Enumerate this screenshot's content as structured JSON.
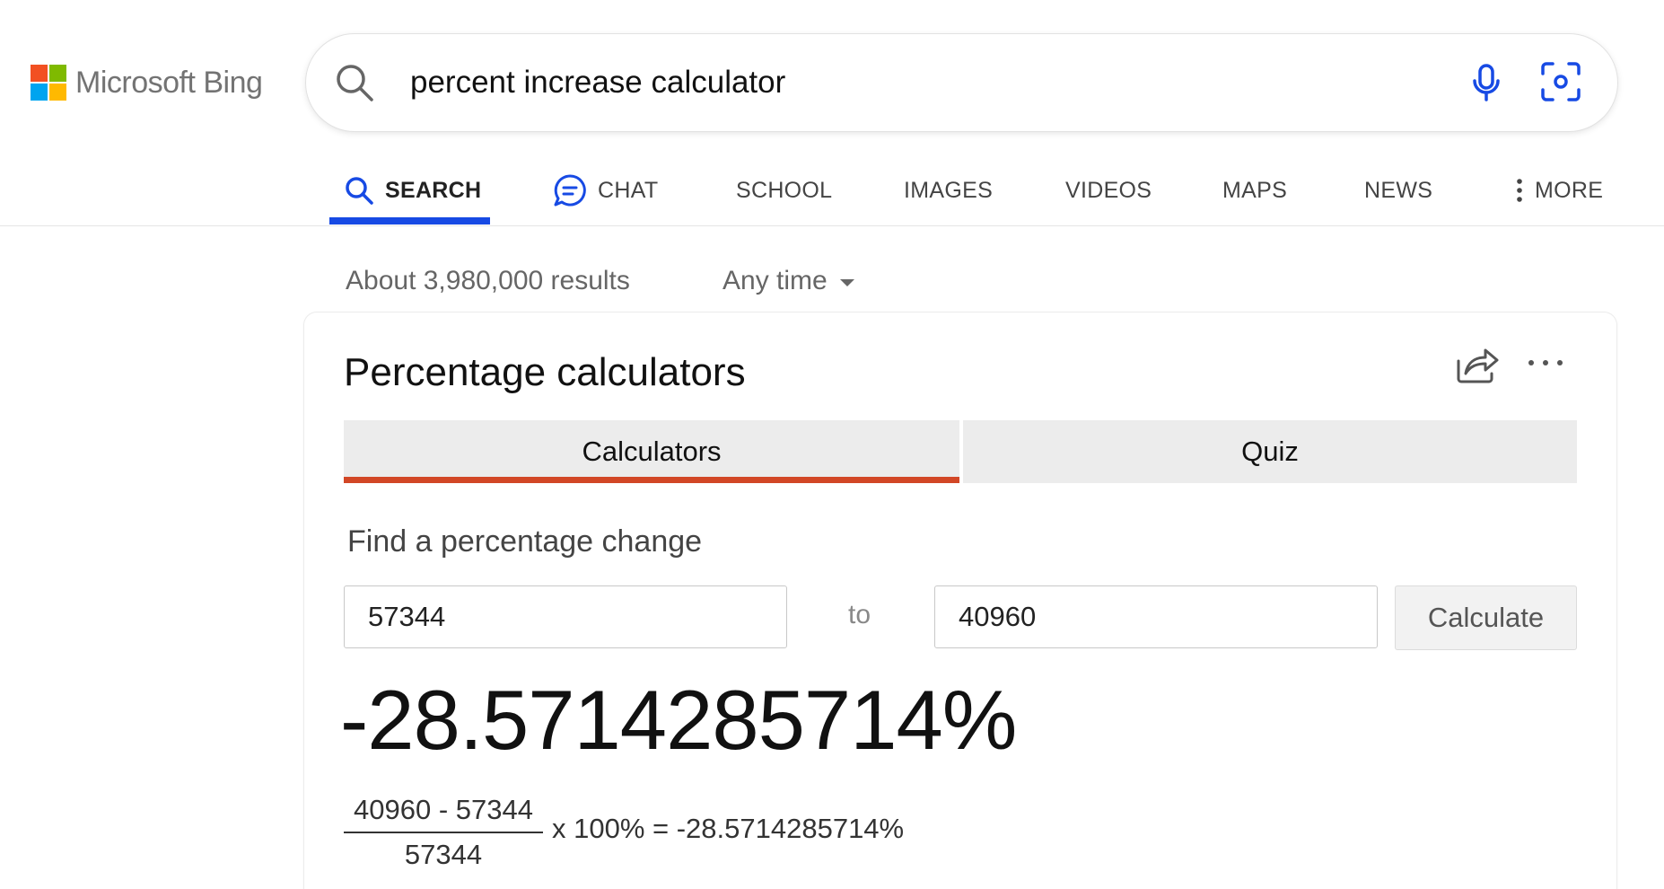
{
  "header": {
    "logo_text": "Microsoft Bing",
    "logo_colors": [
      "#f25022",
      "#7fba00",
      "#00a4ef",
      "#ffb900"
    ],
    "search_query": "percent increase calculator"
  },
  "nav": {
    "accent_color": "#174ae4",
    "items": [
      {
        "label": "SEARCH",
        "icon": "search-icon",
        "active": true
      },
      {
        "label": "CHAT",
        "icon": "chat-icon"
      },
      {
        "label": "SCHOOL"
      },
      {
        "label": "IMAGES"
      },
      {
        "label": "VIDEOS"
      },
      {
        "label": "MAPS"
      },
      {
        "label": "NEWS"
      },
      {
        "label": "MORE",
        "icon": "kebab-icon"
      }
    ]
  },
  "results": {
    "count_text": "About 3,980,000 results",
    "time_filter": "Any time"
  },
  "card": {
    "title": "Percentage calculators",
    "tabs": [
      {
        "label": "Calculators",
        "active": true
      },
      {
        "label": "Quiz"
      }
    ],
    "tab_accent_color": "#d24726",
    "subtitle": "Find a percentage change",
    "from_value": "57344",
    "to_label": "to",
    "to_value": "40960",
    "calculate_label": "Calculate",
    "result": "-28.5714285714%",
    "formula": {
      "numerator": "40960 - 57344",
      "denominator": "57344",
      "rest": "x 100% = -28.5714285714%"
    }
  }
}
